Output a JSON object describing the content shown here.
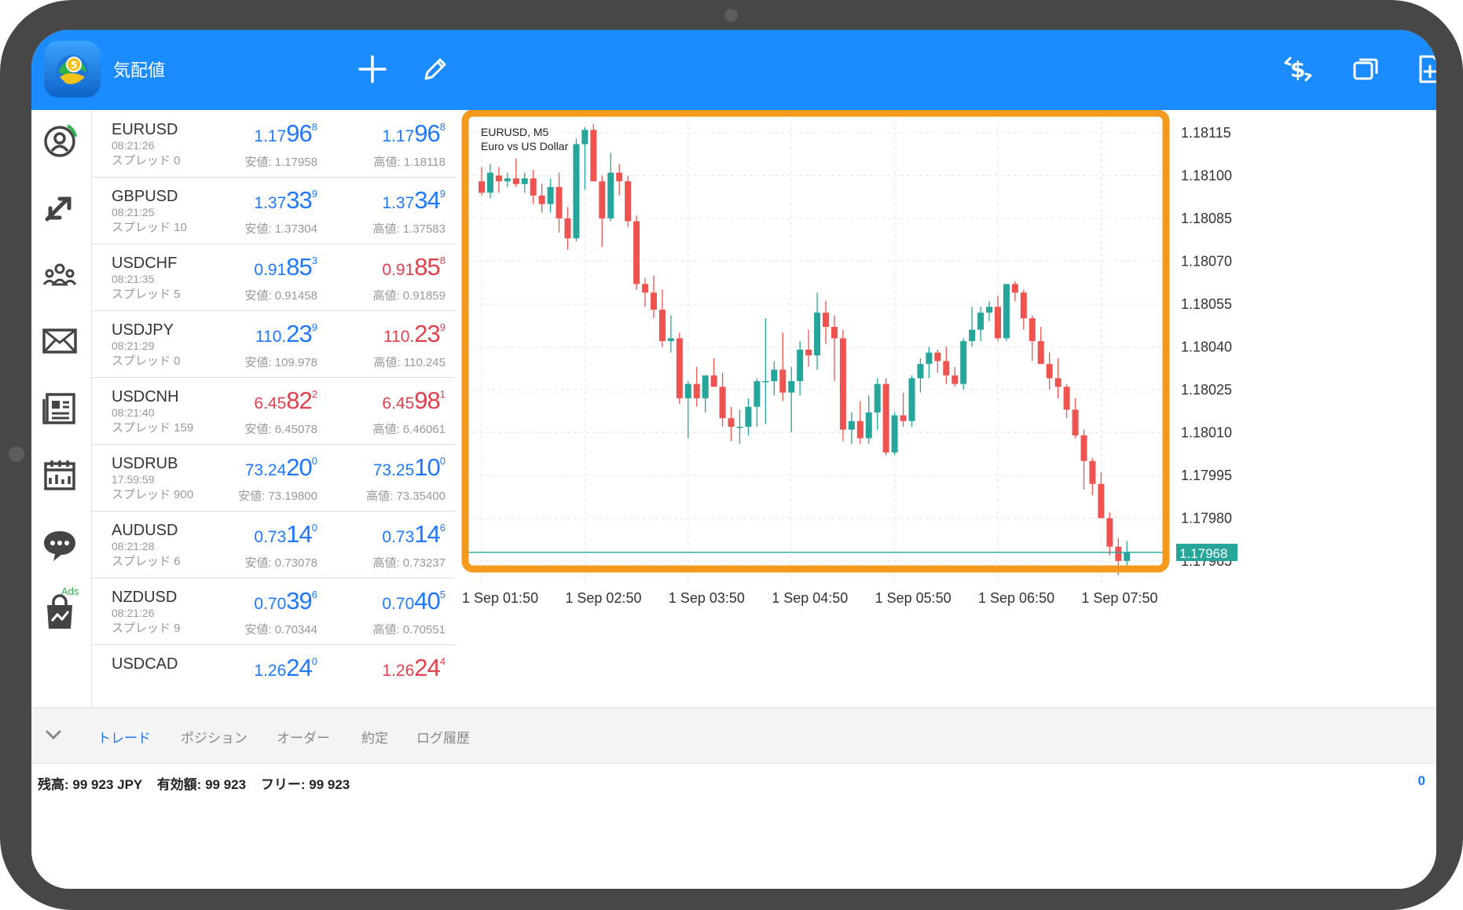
{
  "header": {
    "title": "気配値",
    "add_icon": "plus-icon",
    "edit_icon": "pencil-icon",
    "right_icons": [
      "dollar-exchange-icon",
      "windows-icon",
      "new-document-icon"
    ]
  },
  "sidebar": {
    "items": [
      {
        "icon": "account-icon"
      },
      {
        "icon": "trade-arrows-icon"
      },
      {
        "icon": "community-icon"
      },
      {
        "icon": "mail-icon"
      },
      {
        "icon": "news-icon"
      },
      {
        "icon": "calendar-icon",
        "badge": "Ads"
      },
      {
        "icon": "chat-icon"
      },
      {
        "icon": "market-bag-icon"
      }
    ]
  },
  "quotes": [
    {
      "symbol": "EURUSD",
      "time": "08:21:26",
      "spread": "スプレッド 0",
      "bid_prefix": "1.17",
      "bid_big": "96",
      "bid_sup": "8",
      "bid_dir": "up",
      "ask_prefix": "1.17",
      "ask_big": "96",
      "ask_sup": "8",
      "ask_dir": "up",
      "low": "安値: 1.17958",
      "high": "高値: 1.18118"
    },
    {
      "symbol": "GBPUSD",
      "time": "08:21:25",
      "spread": "スプレッド 10",
      "bid_prefix": "1.37",
      "bid_big": "33",
      "bid_sup": "9",
      "bid_dir": "up",
      "ask_prefix": "1.37",
      "ask_big": "34",
      "ask_sup": "9",
      "ask_dir": "up",
      "low": "安値: 1.37304",
      "high": "高値: 1.37583"
    },
    {
      "symbol": "USDCHF",
      "time": "08:21:35",
      "spread": "スプレッド 5",
      "bid_prefix": "0.91",
      "bid_big": "85",
      "bid_sup": "3",
      "bid_dir": "up",
      "ask_prefix": "0.91",
      "ask_big": "85",
      "ask_sup": "8",
      "ask_dir": "dn",
      "low": "安値: 0.91458",
      "high": "高値: 0.91859"
    },
    {
      "symbol": "USDJPY",
      "time": "08:21:29",
      "spread": "スプレッド 0",
      "bid_prefix": "110.",
      "bid_big": "23",
      "bid_sup": "9",
      "bid_dir": "up",
      "ask_prefix": "110.",
      "ask_big": "23",
      "ask_sup": "9",
      "ask_dir": "dn",
      "low": "安値: 109.978",
      "high": "高値: 110.245"
    },
    {
      "symbol": "USDCNH",
      "time": "08:21:40",
      "spread": "スプレッド 159",
      "bid_prefix": "6.45",
      "bid_big": "82",
      "bid_sup": "2",
      "bid_dir": "dn",
      "ask_prefix": "6.45",
      "ask_big": "98",
      "ask_sup": "1",
      "ask_dir": "dn",
      "low": "安値: 6.45078",
      "high": "高値: 6.46061"
    },
    {
      "symbol": "USDRUB",
      "time": "17:59:59",
      "spread": "スプレッド 900",
      "bid_prefix": "73.24",
      "bid_big": "20",
      "bid_sup": "0",
      "bid_dir": "up",
      "ask_prefix": "73.25",
      "ask_big": "10",
      "ask_sup": "0",
      "ask_dir": "up",
      "low": "安値: 73.19800",
      "high": "高値: 73.35400"
    },
    {
      "symbol": "AUDUSD",
      "time": "08:21:28",
      "spread": "スプレッド 6",
      "bid_prefix": "0.73",
      "bid_big": "14",
      "bid_sup": "0",
      "bid_dir": "up",
      "ask_prefix": "0.73",
      "ask_big": "14",
      "ask_sup": "6",
      "ask_dir": "up",
      "low": "安値: 0.73078",
      "high": "高値: 0.73237"
    },
    {
      "symbol": "NZDUSD",
      "time": "08:21:26",
      "spread": "スプレッド 9",
      "bid_prefix": "0.70",
      "bid_big": "39",
      "bid_sup": "6",
      "bid_dir": "up",
      "ask_prefix": "0.70",
      "ask_big": "40",
      "ask_sup": "5",
      "ask_dir": "up",
      "low": "安値: 0.70344",
      "high": "高値: 0.70551"
    },
    {
      "symbol": "USDCAD",
      "time": "",
      "spread": "",
      "bid_prefix": "1.26",
      "bid_big": "24",
      "bid_sup": "0",
      "bid_dir": "up",
      "ask_prefix": "1.26",
      "ask_big": "24",
      "ask_sup": "4",
      "ask_dir": "dn",
      "low": "",
      "high": ""
    }
  ],
  "tabs": [
    {
      "label": "トレード",
      "active": true
    },
    {
      "label": "ポジション",
      "active": false
    },
    {
      "label": "オーダー",
      "active": false
    },
    {
      "label": "約定",
      "active": false
    },
    {
      "label": "ログ履歴",
      "active": false
    }
  ],
  "account": {
    "balance_label": "残高:",
    "balance": "99 923 JPY",
    "equity_label": "有効額:",
    "equity": "99 923",
    "free_label": "フリー:",
    "free": "99 923",
    "right_value": "0"
  },
  "colors": {
    "accent": "#1b8cff",
    "bull": "#26a69a",
    "bear": "#ef5350",
    "highlight": "#f39a1e"
  },
  "chart_data": {
    "type": "candlestick",
    "title": "EURUSD, M5",
    "subtitle": "Euro vs US Dollar",
    "current_price": "1.17968",
    "y_ticks": [
      "1.18115",
      "1.18100",
      "1.18085",
      "1.18070",
      "1.18055",
      "1.18040",
      "1.18025",
      "1.18010",
      "1.17995",
      "1.17980",
      "1.17965"
    ],
    "ylim": [
      1.1796,
      1.18118
    ],
    "x_ticks": [
      "1 Sep 01:50",
      "1 Sep 02:50",
      "1 Sep 03:50",
      "1 Sep 04:50",
      "1 Sep 05:50",
      "1 Sep 06:50",
      "1 Sep 07:50"
    ],
    "x_tick_index": [
      0,
      12,
      24,
      36,
      48,
      60,
      72
    ],
    "candles": [
      [
        1.18098,
        1.18103,
        1.18093,
        1.18094
      ],
      [
        1.18094,
        1.18104,
        1.18092,
        1.18101
      ],
      [
        1.181,
        1.18103,
        1.18094,
        1.18098
      ],
      [
        1.18098,
        1.18101,
        1.18096,
        1.18099
      ],
      [
        1.18099,
        1.18106,
        1.18096,
        1.18097
      ],
      [
        1.18097,
        1.18101,
        1.18094,
        1.18099
      ],
      [
        1.18099,
        1.18102,
        1.1809,
        1.18093
      ],
      [
        1.18093,
        1.18097,
        1.18087,
        1.1809
      ],
      [
        1.1809,
        1.18099,
        1.18087,
        1.18096
      ],
      [
        1.18096,
        1.18101,
        1.1808,
        1.18085
      ],
      [
        1.18085,
        1.18089,
        1.18074,
        1.18078
      ],
      [
        1.18078,
        1.18113,
        1.18077,
        1.18111
      ],
      [
        1.18111,
        1.18117,
        1.18095,
        1.18116
      ],
      [
        1.18116,
        1.18118,
        1.18098,
        1.18098
      ],
      [
        1.18098,
        1.181,
        1.18075,
        1.18085
      ],
      [
        1.18085,
        1.18108,
        1.18084,
        1.18101
      ],
      [
        1.18101,
        1.18104,
        1.18093,
        1.18098
      ],
      [
        1.18098,
        1.181,
        1.18082,
        1.18084
      ],
      [
        1.18084,
        1.18086,
        1.1806,
        1.18062
      ],
      [
        1.18062,
        1.18064,
        1.18054,
        1.18059
      ],
      [
        1.18059,
        1.18065,
        1.1805,
        1.18053
      ],
      [
        1.18053,
        1.1806,
        1.1804,
        1.18042
      ],
      [
        1.18042,
        1.18051,
        1.18038,
        1.18043
      ],
      [
        1.18043,
        1.18045,
        1.1802,
        1.18022
      ],
      [
        1.18022,
        1.18028,
        1.18008,
        1.18027
      ],
      [
        1.18027,
        1.18033,
        1.18019,
        1.18022
      ],
      [
        1.18022,
        1.1803,
        1.18017,
        1.1803
      ],
      [
        1.1803,
        1.18036,
        1.18026,
        1.18026
      ],
      [
        1.18026,
        1.18031,
        1.18012,
        1.18015
      ],
      [
        1.18015,
        1.18019,
        1.18007,
        1.18012
      ],
      [
        1.18012,
        1.18018,
        1.18006,
        1.18012
      ],
      [
        1.18012,
        1.18022,
        1.18009,
        1.18019
      ],
      [
        1.18019,
        1.18029,
        1.18012,
        1.18028
      ],
      [
        1.18028,
        1.1805,
        1.18013,
        1.18028
      ],
      [
        1.18028,
        1.18035,
        1.18023,
        1.18032
      ],
      [
        1.18032,
        1.18045,
        1.18021,
        1.18024
      ],
      [
        1.18024,
        1.18033,
        1.1801,
        1.18028
      ],
      [
        1.18028,
        1.18042,
        1.18023,
        1.18039
      ],
      [
        1.18039,
        1.18046,
        1.18033,
        1.18037
      ],
      [
        1.18037,
        1.18059,
        1.18032,
        1.18052
      ],
      [
        1.18052,
        1.18056,
        1.18041,
        1.18047
      ],
      [
        1.18047,
        1.18051,
        1.18028,
        1.18043
      ],
      [
        1.18043,
        1.18046,
        1.18007,
        1.18011
      ],
      [
        1.18011,
        1.18017,
        1.18006,
        1.18014
      ],
      [
        1.18014,
        1.18021,
        1.18006,
        1.18008
      ],
      [
        1.18008,
        1.18023,
        1.18006,
        1.18017
      ],
      [
        1.18017,
        1.18029,
        1.18011,
        1.18027
      ],
      [
        1.18027,
        1.18029,
        1.18002,
        1.18003
      ],
      [
        1.18003,
        1.18017,
        1.18002,
        1.18016
      ],
      [
        1.18016,
        1.18024,
        1.18012,
        1.18014
      ],
      [
        1.18014,
        1.1803,
        1.18012,
        1.18029
      ],
      [
        1.18029,
        1.18036,
        1.18024,
        1.18034
      ],
      [
        1.18034,
        1.1804,
        1.18029,
        1.18038
      ],
      [
        1.18038,
        1.18039,
        1.18031,
        1.18035
      ],
      [
        1.18035,
        1.1804,
        1.18027,
        1.1803
      ],
      [
        1.1803,
        1.18033,
        1.18026,
        1.18027
      ],
      [
        1.18027,
        1.18043,
        1.18025,
        1.18042
      ],
      [
        1.18042,
        1.18054,
        1.1804,
        1.18046
      ],
      [
        1.18046,
        1.18054,
        1.18042,
        1.18052
      ],
      [
        1.18052,
        1.18056,
        1.18049,
        1.18054
      ],
      [
        1.18054,
        1.18058,
        1.18042,
        1.18043
      ],
      [
        1.18043,
        1.18062,
        1.18042,
        1.18062
      ],
      [
        1.18062,
        1.18063,
        1.18056,
        1.18059
      ],
      [
        1.18059,
        1.1806,
        1.18046,
        1.1805
      ],
      [
        1.1805,
        1.18051,
        1.18035,
        1.18042
      ],
      [
        1.18042,
        1.18047,
        1.18037,
        1.18034
      ],
      [
        1.18034,
        1.18038,
        1.18025,
        1.18029
      ],
      [
        1.18029,
        1.18036,
        1.18022,
        1.18026
      ],
      [
        1.18026,
        1.18027,
        1.18015,
        1.18018
      ],
      [
        1.18018,
        1.18022,
        1.18008,
        1.18009
      ],
      [
        1.18009,
        1.18011,
        1.1799,
        1.18
      ],
      [
        1.18,
        1.18001,
        1.17988,
        1.17992
      ],
      [
        1.17992,
        1.17996,
        1.17983,
        1.1798
      ],
      [
        1.1798,
        1.17982,
        1.17967,
        1.1797
      ],
      [
        1.1797,
        1.17973,
        1.1796,
        1.17965
      ],
      [
        1.17965,
        1.17972,
        1.17961,
        1.17968
      ]
    ]
  }
}
